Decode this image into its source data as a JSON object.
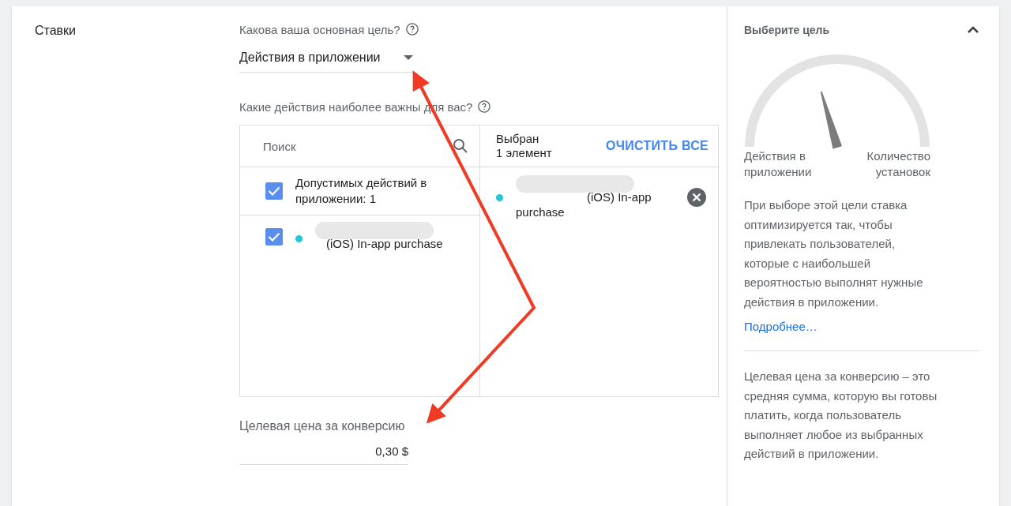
{
  "section": {
    "title": "Ставки"
  },
  "goal": {
    "question": "Какова ваша основная цель?",
    "value": "Действия в приложении"
  },
  "actions": {
    "question": "Какие действия наиболее важны для вас?",
    "search": {
      "placeholder": "Поиск"
    },
    "select_all": {
      "label": "Допустимых действий в приложении: 1",
      "checked": true
    },
    "items": [
      {
        "label": "(iOS) In-app purchase",
        "checked": true,
        "color": "#26c6da"
      }
    ],
    "selected_header": {
      "title": "Выбран",
      "count": "1 элемент",
      "clear": "ОЧИСТИТЬ ВСЕ"
    },
    "selected": [
      {
        "label": "(iOS) In-app purchase",
        "color": "#26c6da"
      }
    ]
  },
  "target_cpa": {
    "label": "Целевая цена за конверсию",
    "value": "0,30 $"
  },
  "panel": {
    "title": "Выберите цель",
    "expanded": true,
    "gauge": {
      "level": 0.41,
      "left": "Действия в приложении",
      "right": "Количество установок"
    },
    "description": "При выборе этой цели ставка оптимизируется так, чтобы привлекать пользователей, которые с наибольшей вероятностью выполнят нужные действия в приложении.",
    "link": "Подробнее…",
    "cpa_description": "Целевая цена за конверсию – это средняя сумма, которую вы готовы платить, когда пользователь выполняет любое из выбранных действий в приложении."
  }
}
